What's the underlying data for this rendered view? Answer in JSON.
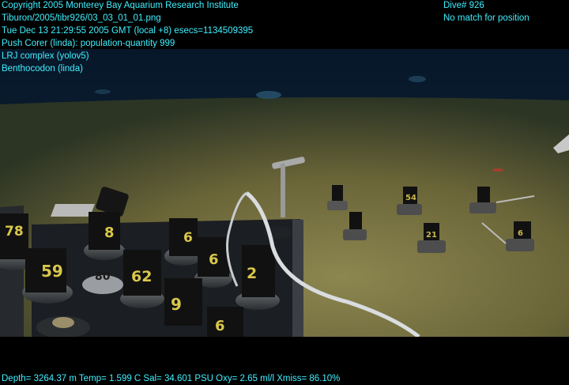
{
  "overlay": {
    "left_lines": [
      "Copyright 2005 Monterey Bay Aquarium Research Institute",
      "Tiburon/2005/tibr926/03_03_01_01.png",
      "Tue Dec 13 21:29:55 2005 GMT (local +8)  esecs=1134509395",
      "Push Corer (linda): population-quantity 999",
      "LRJ complex (yolov5)",
      "Benthocodon (linda)"
    ],
    "right_lines": [
      "Dive# 926",
      "No match for position"
    ],
    "bottom_line": "Depth= 3264.37 m  Temp= 1.599 C  Sal= 34.601 PSU  Oxy= 2.65 ml/l  Xmiss= 86.10%"
  },
  "colors": {
    "overlay_text": "#3ff0ff",
    "sediment": "#6f6a3c",
    "water": "#08182a"
  },
  "scene": {
    "rack_corer_labels": [
      "78",
      "8",
      "6",
      "59",
      "80",
      "62",
      "6",
      "2",
      "9",
      "6"
    ],
    "field_corer_labels": [
      "54",
      "21",
      "6"
    ]
  }
}
